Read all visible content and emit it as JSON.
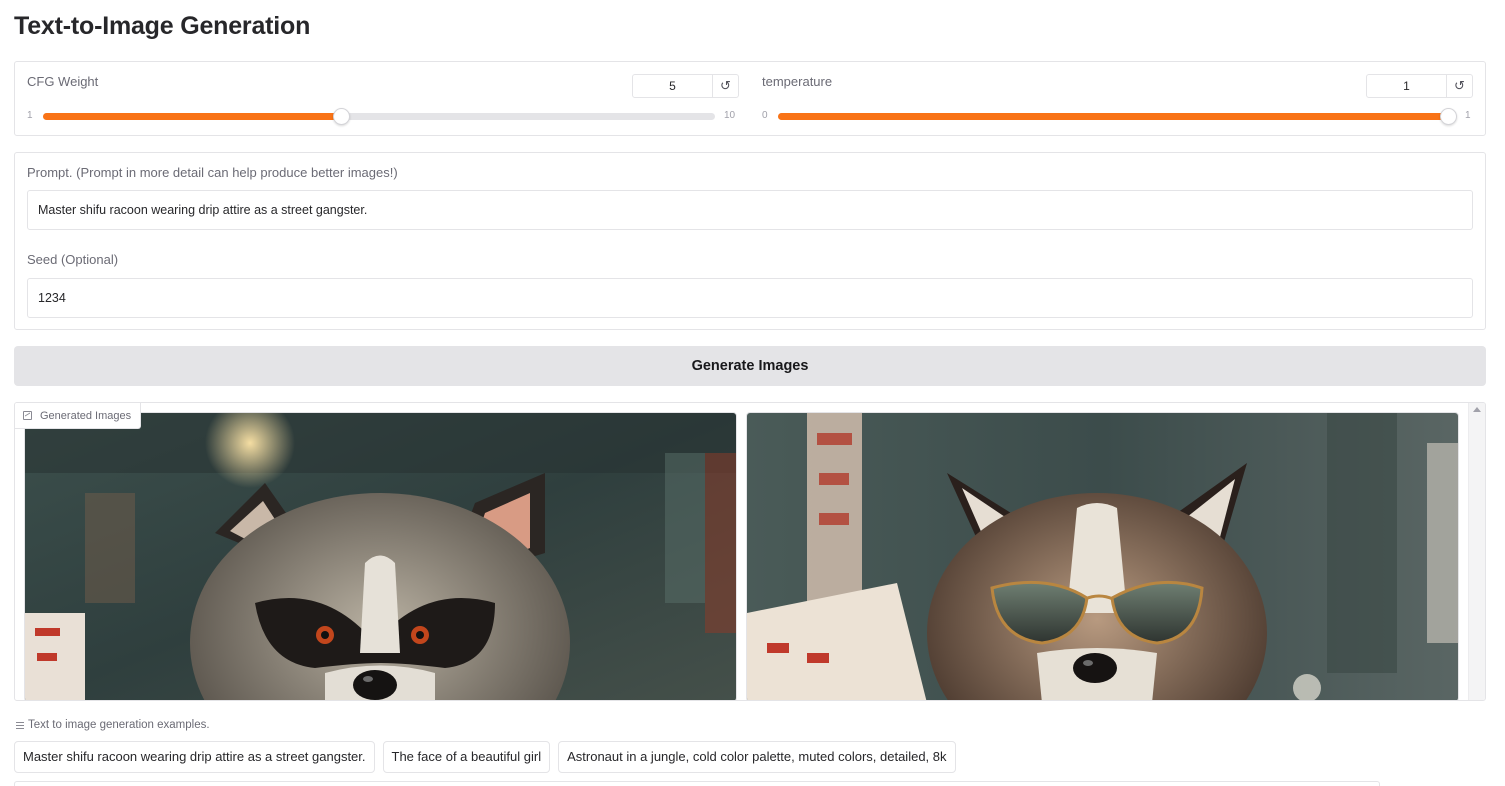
{
  "page": {
    "title": "Text-to-Image Generation"
  },
  "cfg_weight": {
    "label": "CFG Weight",
    "value": "5",
    "min": "1",
    "max": "10",
    "fraction": 0.444,
    "reset_icon": "reset-icon"
  },
  "temperature": {
    "label": "temperature",
    "value": "1",
    "min": "0",
    "max": "1",
    "fraction": 1.0,
    "reset_icon": "reset-icon"
  },
  "prompt": {
    "label": "Prompt. (Prompt in more detail can help produce better images!)",
    "value": "Master shifu racoon wearing drip attire as a street gangster."
  },
  "seed": {
    "label": "Seed (Optional)",
    "value": "1234"
  },
  "generate": {
    "label": "Generate Images"
  },
  "gallery": {
    "label": "Generated Images",
    "icon": "image-icon"
  },
  "examples": {
    "label": "Text to image generation examples.",
    "icon": "list-icon",
    "items": [
      "Master shifu racoon wearing drip attire as a street gangster.",
      "The face of a beautiful girl",
      "Astronaut in a jungle, cold color palette, muted colors, detailed, 8k"
    ]
  },
  "colors": {
    "accent": "#f97316",
    "border": "#e4e4e7",
    "button_bg": "#e4e4e7"
  }
}
